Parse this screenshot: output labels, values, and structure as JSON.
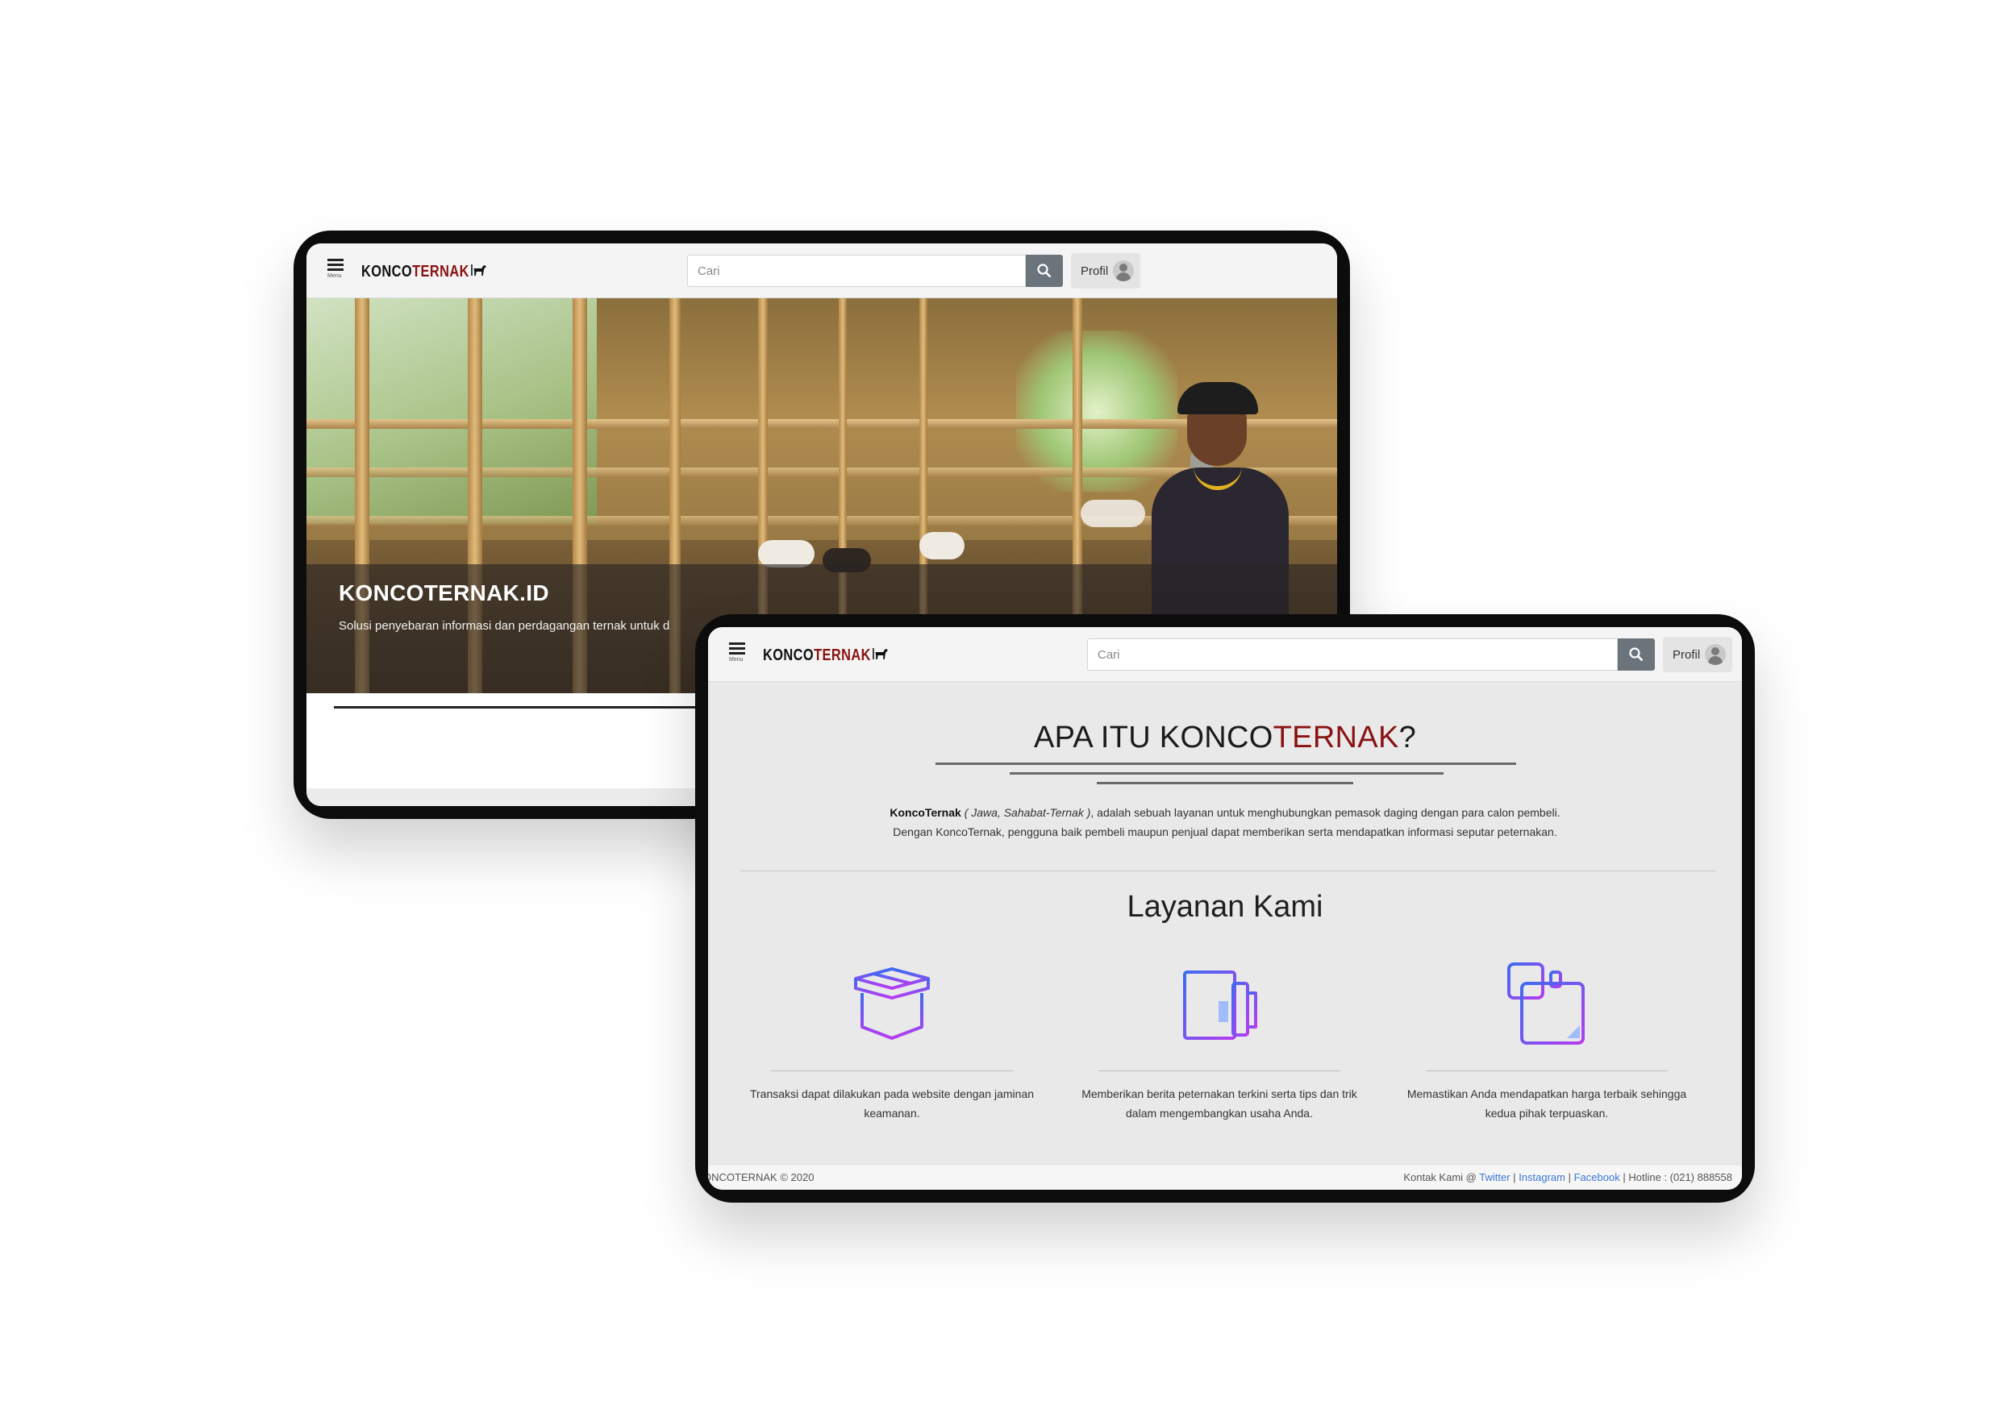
{
  "navbar": {
    "menu_label": "Menu",
    "logo_part1": "KONCO",
    "logo_part2": "TERNAK",
    "search_placeholder": "Cari",
    "profile_label": "Profil"
  },
  "hero": {
    "title": "KONCOTERNAK.ID",
    "subtitle": "Solusi penyebaran informasi dan perdagangan ternak untuk d"
  },
  "about": {
    "title_prefix": "APA ITU KONCO",
    "title_highlight": "TERNAK",
    "title_suffix": "?",
    "brand": "KoncoTernak",
    "brand_note": "( Jawa, Sahabat-Ternak )",
    "description": ", adalah sebuah layanan untuk menghubungkan pemasok daging dengan para calon pembeli. Dengan KoncoTernak, pengguna baik pembeli maupun penjual dapat memberikan serta mendapatkan informasi seputar peternakan."
  },
  "services": {
    "title": "Layanan Kami",
    "items": [
      {
        "icon": "box-icon",
        "text": "Transaksi dapat dilakukan pada website dengan jaminan keamanan."
      },
      {
        "icon": "newspaper-icon",
        "text": "Memberikan berita peternakan terkini serta tips dan trik dalam mengembangkan usaha Anda."
      },
      {
        "icon": "calculator-price-icon",
        "text": "Memastikan Anda mendapatkan harga terbaik sehingga kedua pihak terpuaskan."
      }
    ]
  },
  "footer": {
    "copyright": "ONCOTERNAK © 2020",
    "contact_prefix": "Kontak Kami @",
    "links": [
      "Twitter",
      "Instagram",
      "Facebook"
    ],
    "separator": "|",
    "hotline": "| Hotline : (021) 888558"
  },
  "colors": {
    "brand_red": "#8a1212",
    "search_button": "#6b737b",
    "link_blue": "#3a78d8",
    "icon_gradient_start": "#3d6cf0",
    "icon_gradient_end": "#b53df0"
  }
}
